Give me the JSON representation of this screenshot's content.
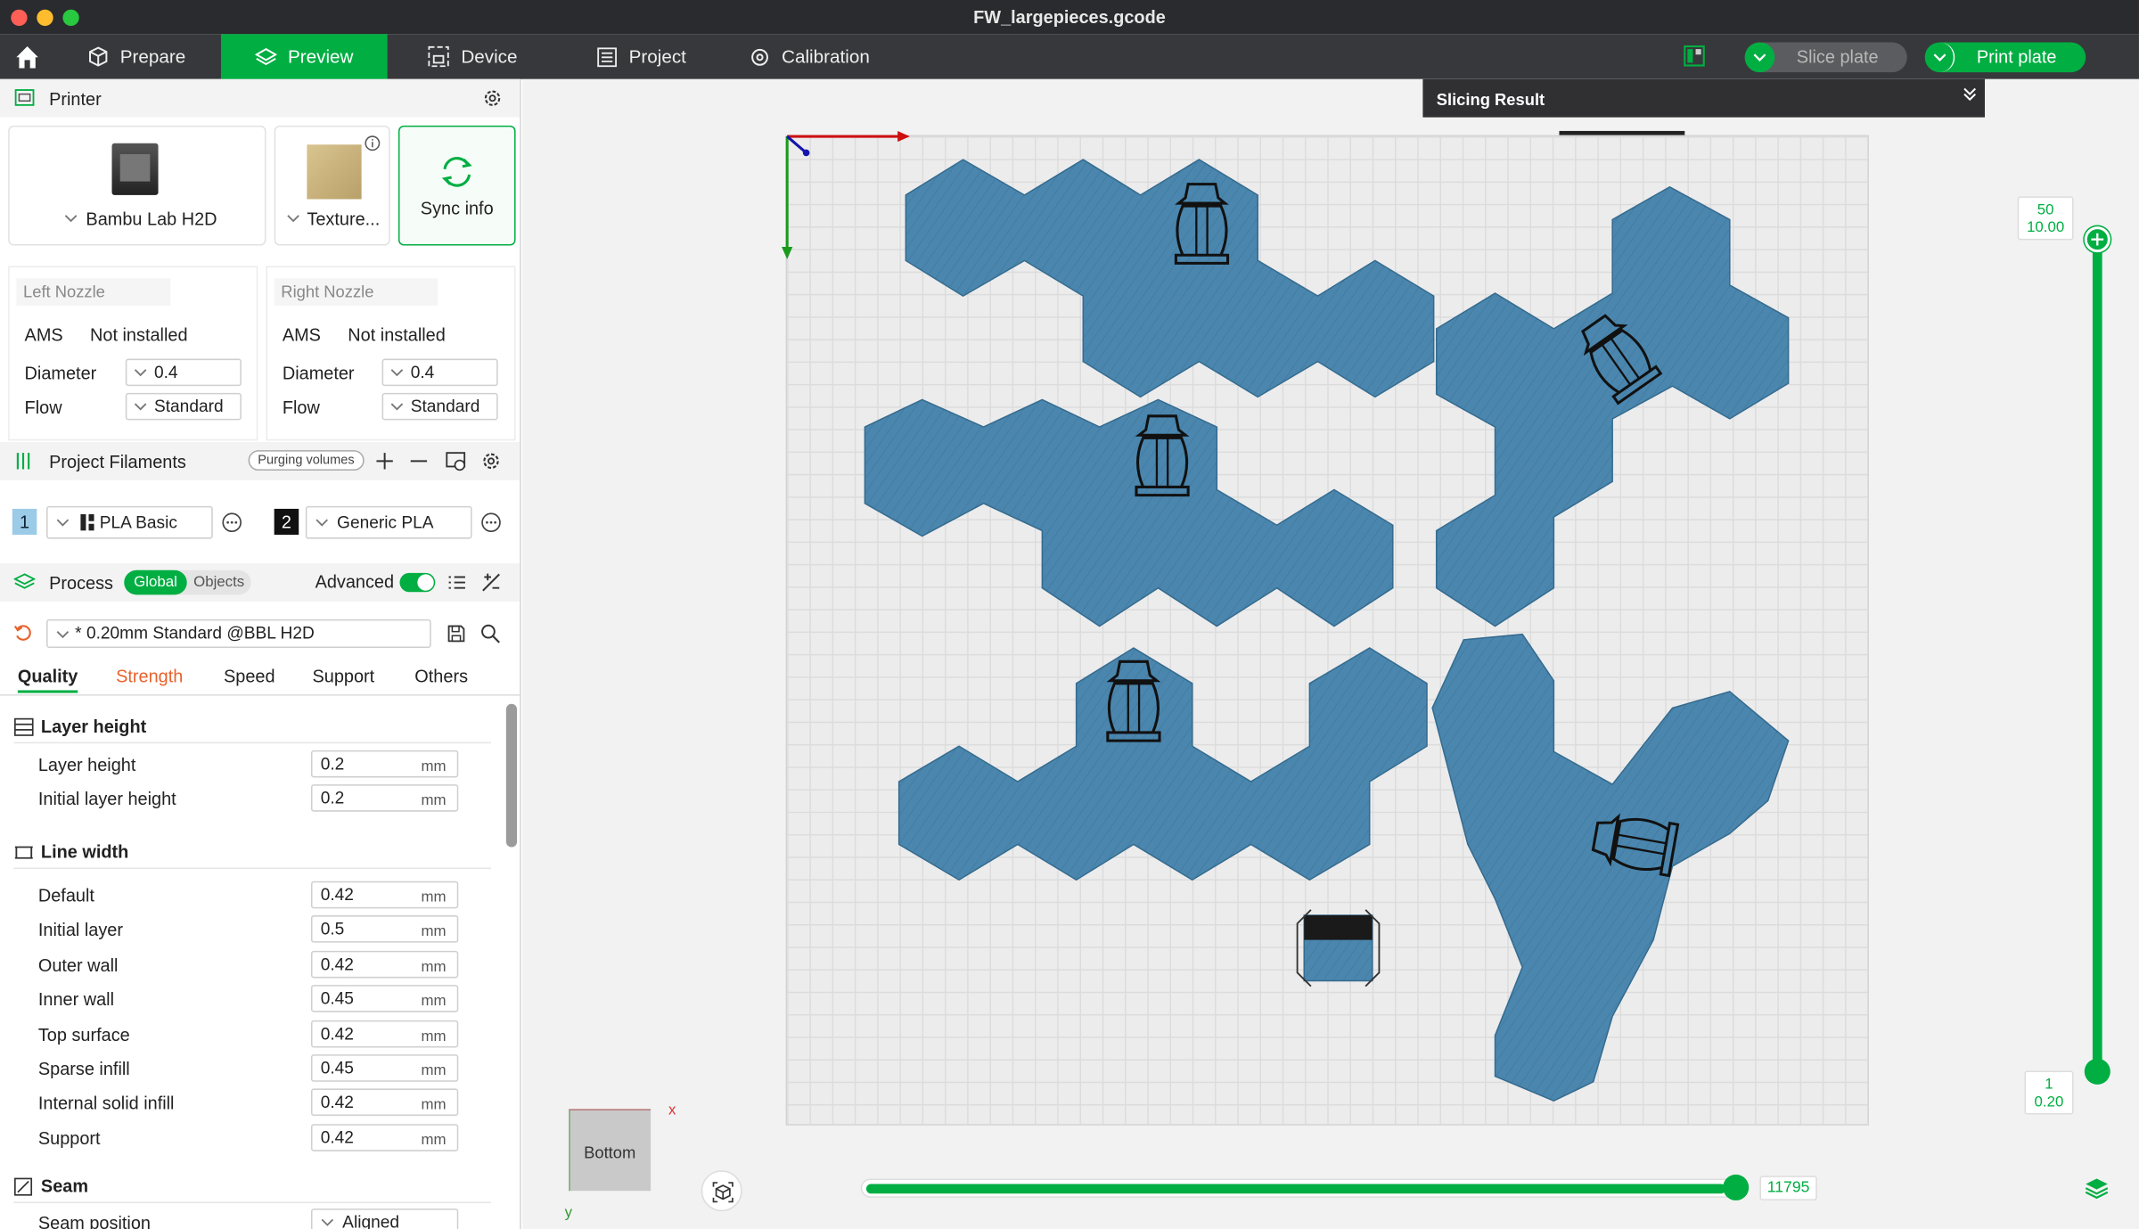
{
  "window": {
    "title": "FW_largepieces.gcode"
  },
  "menu": {
    "prepare": "Prepare",
    "preview": "Preview",
    "device": "Device",
    "project": "Project",
    "calibration": "Calibration",
    "slice_plate": "Slice plate",
    "print_plate": "Print plate"
  },
  "printer": {
    "section_title": "Printer",
    "printer_name": "Bambu Lab H2D",
    "plate_type": "Texture...",
    "sync_label": "Sync info",
    "left_nozzle": {
      "title": "Left Nozzle",
      "ams_label": "AMS",
      "ams_value": "Not installed",
      "diameter_label": "Diameter",
      "diameter_value": "0.4",
      "flow_label": "Flow",
      "flow_value": "Standard"
    },
    "right_nozzle": {
      "title": "Right Nozzle",
      "ams_label": "AMS",
      "ams_value": "Not installed",
      "diameter_label": "Diameter",
      "diameter_value": "0.4",
      "flow_label": "Flow",
      "flow_value": "Standard"
    }
  },
  "filaments": {
    "section_title": "Project Filaments",
    "purging_label": "Purging volumes",
    "items": [
      {
        "index": "1",
        "name": "PLA Basic"
      },
      {
        "index": "2",
        "name": "Generic PLA"
      }
    ]
  },
  "process": {
    "section_title": "Process",
    "global_label": "Global",
    "objects_label": "Objects",
    "advanced_label": "Advanced",
    "preset": "* 0.20mm Standard @BBL H2D",
    "tabs": [
      {
        "label": "Quality"
      },
      {
        "label": "Strength"
      },
      {
        "label": "Speed"
      },
      {
        "label": "Support"
      },
      {
        "label": "Others"
      }
    ],
    "layer_height": {
      "title": "Layer height",
      "rows": [
        {
          "label": "Layer height",
          "value": "0.2",
          "unit": "mm"
        },
        {
          "label": "Initial layer height",
          "value": "0.2",
          "unit": "mm"
        }
      ]
    },
    "line_width": {
      "title": "Line width",
      "rows": [
        {
          "label": "Default",
          "value": "0.42",
          "unit": "mm"
        },
        {
          "label": "Initial layer",
          "value": "0.5",
          "unit": "mm"
        },
        {
          "label": "Outer wall",
          "value": "0.42",
          "unit": "mm"
        },
        {
          "label": "Inner wall",
          "value": "0.45",
          "unit": "mm"
        },
        {
          "label": "Top surface",
          "value": "0.42",
          "unit": "mm"
        },
        {
          "label": "Sparse infill",
          "value": "0.45",
          "unit": "mm"
        },
        {
          "label": "Internal solid infill",
          "value": "0.42",
          "unit": "mm"
        },
        {
          "label": "Support",
          "value": "0.42",
          "unit": "mm"
        }
      ]
    },
    "seam": {
      "title": "Seam",
      "rows": [
        {
          "label": "Seam position",
          "value": "Aligned"
        }
      ]
    }
  },
  "viewport": {
    "slicing_result": "Slicing Result",
    "view_label": "Bottom",
    "axis_x": "x",
    "axis_y": "y",
    "layer_top": {
      "layer": "50",
      "height": "10.00"
    },
    "layer_bottom": {
      "layer": "1",
      "height": "0.20"
    },
    "move_value": "11795",
    "layer_slider_fraction": 1.0,
    "move_slider_fraction": 1.0
  },
  "colors": {
    "accent": "#00ae42",
    "model": "#4a86ae",
    "menubar": "#37383b",
    "titlebar": "#2a2b2e"
  }
}
